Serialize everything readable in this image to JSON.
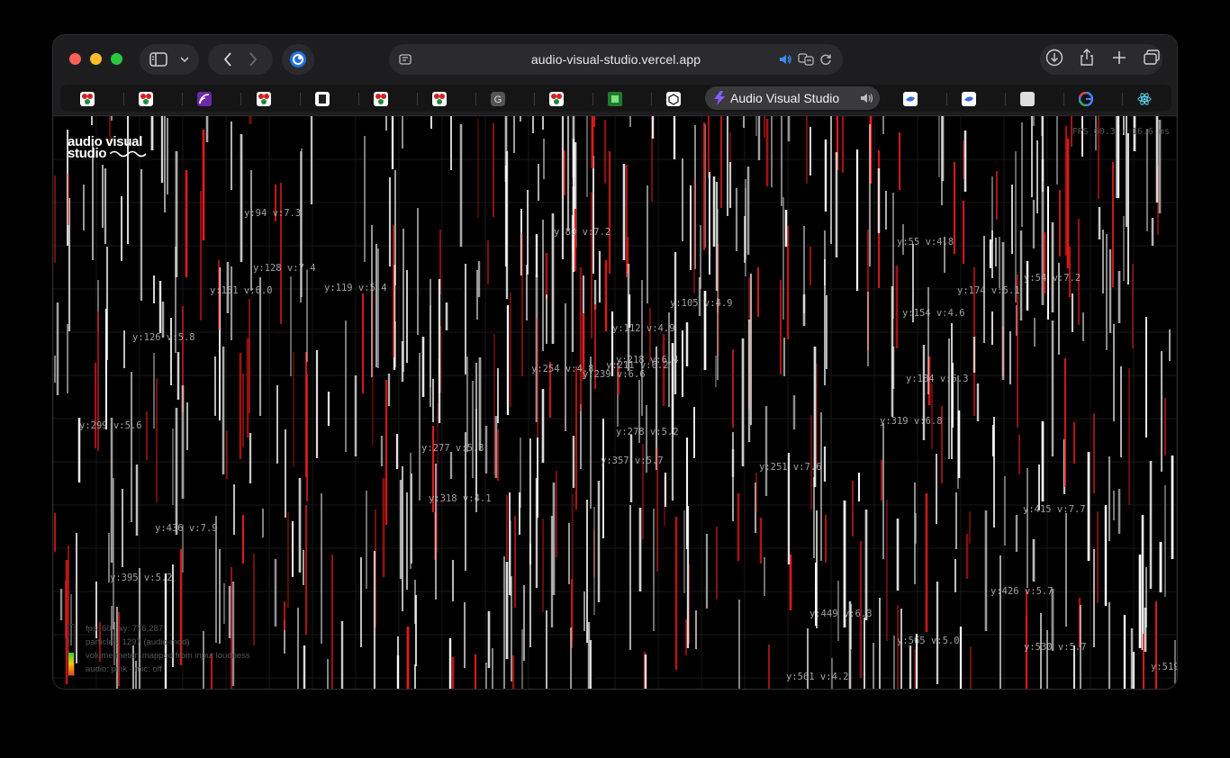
{
  "browser": {
    "url": "audio-visual-studio.vercel.app",
    "active_tab_title": "Audio Visual Studio",
    "tab_icons": [
      "red-cluster-icon",
      "red-cluster-icon",
      "purple-feed-icon",
      "red-cluster-icon",
      "book-icon",
      "red-cluster-icon",
      "red-cluster-icon",
      "g-letter-icon",
      "red-cluster-icon",
      "green-puzzle-icon",
      "cube-icon",
      "lightning-icon",
      "blue-bird-icon",
      "blue-bird-icon",
      "white-square-icon",
      "google-icon",
      "react-icon"
    ],
    "g_letter": "G"
  },
  "app": {
    "logo_line1": "audio visual",
    "logo_line2": "studio",
    "fps_text": "FPS 60.3 · 16.6 ms",
    "hud": {
      "line1": "fps: 60 · xy: 776,287",
      "line2": "particles: 1297 (audio-mod)",
      "line3": "volume meter: mapped from input loudness",
      "line4": "audio: pink · mic: off"
    },
    "meter_level": 0.45,
    "labels": [
      "y:94 v:7.3",
      "y:80 v:7.2",
      "y:55 v:4.8",
      "y:128 v:7.4",
      "y:151 v:6.0",
      "y:119 v:5.4",
      "y:174 v:5.1",
      "y:54 v:7.2",
      "y:105 v:4.9",
      "y:154 v:4.6",
      "y:112 v:4.9",
      "y:126 v:5.8",
      "y:218 v:6.4",
      "y:254 v:4.8",
      "y:211 v:6.2",
      "y:239 v:6.6",
      "y:184 v:5.3",
      "y:299 v:5.6",
      "y:319 v:6.8",
      "y:278 v:5.2",
      "y:277 v:5.3",
      "y:357 v:5.7",
      "y:251 v:7.6",
      "y:318 v:4.1",
      "y:415 v:7.7",
      "y:436 v:7.9",
      "y:395 v:5.2",
      "y:426 v:5.7",
      "y:449 v:6.3",
      "y:565 v:5.0",
      "y:530 v:5.7",
      "y:561 v:4.2",
      "y:519"
    ]
  },
  "colors": {
    "streak_white": "#ffffff",
    "streak_red": "#e01b1b",
    "background": "#000000"
  }
}
